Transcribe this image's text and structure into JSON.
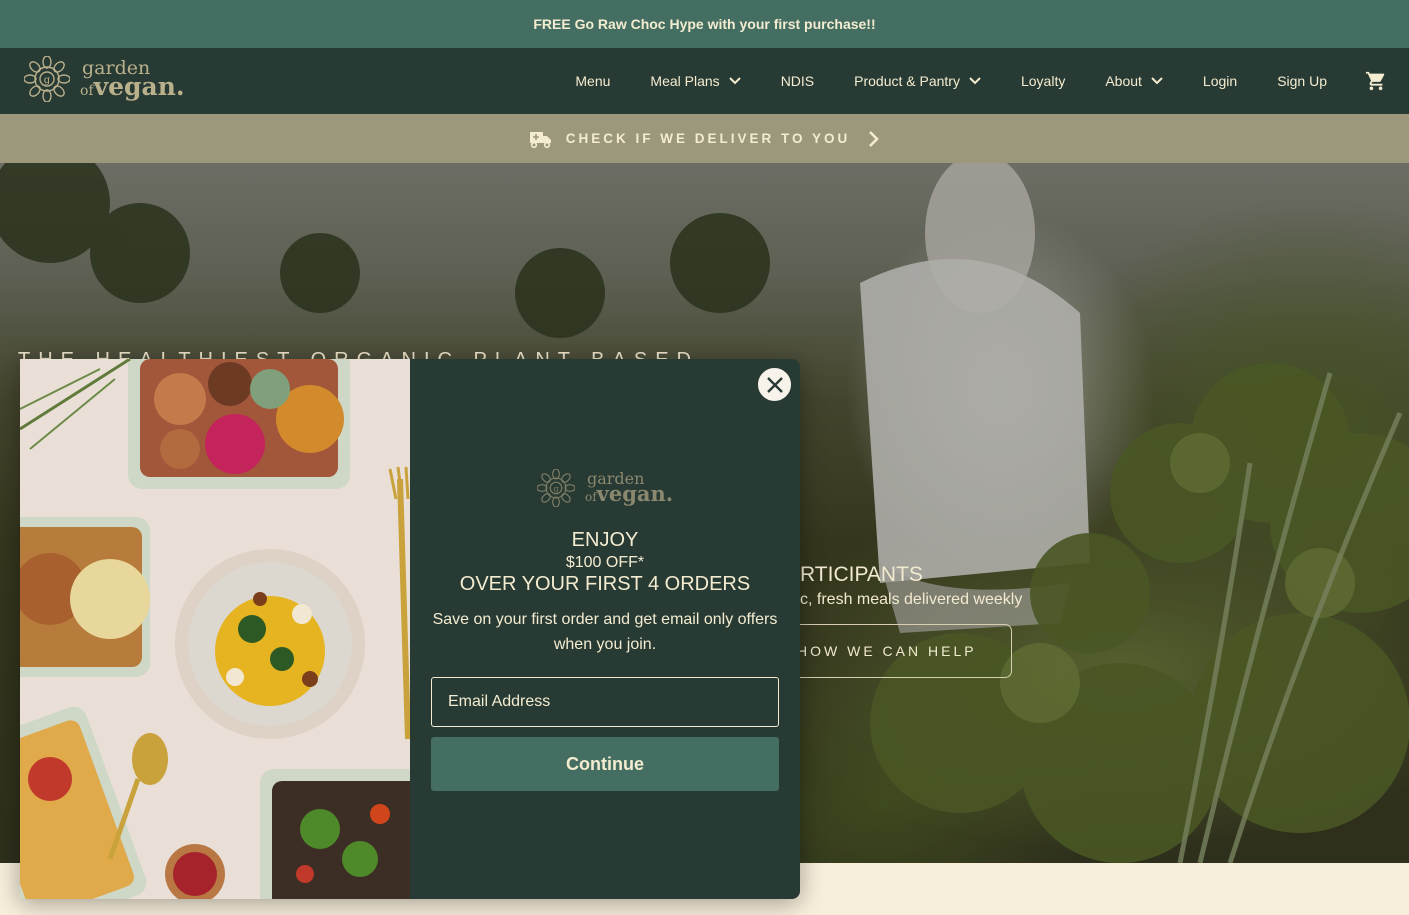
{
  "announcement": {
    "text": "FREE Go Raw Choc Hype with your first purchase!!"
  },
  "brand": {
    "line1": "garden",
    "line2_small": "of",
    "line2_big": "vegan."
  },
  "nav": {
    "items": [
      {
        "label": "Menu",
        "dropdown": false
      },
      {
        "label": "Meal Plans",
        "dropdown": true
      },
      {
        "label": "NDIS",
        "dropdown": false
      },
      {
        "label": "Product & Pantry",
        "dropdown": true
      },
      {
        "label": "Loyalty",
        "dropdown": false
      },
      {
        "label": "About",
        "dropdown": true
      },
      {
        "label": "Login",
        "dropdown": false
      },
      {
        "label": "Sign Up",
        "dropdown": false
      }
    ],
    "cart_icon": "cart-icon"
  },
  "delivery": {
    "label": "CHECK IF WE DELIVER TO YOU",
    "icon": "delivery-truck-icon"
  },
  "hero": {
    "kicker": "THE HEALTHIEST ORGANIC PLANT BASED",
    "heading": "RTICIPANTS",
    "subheading": "c, fresh meals delivered weekly",
    "button_label": "HOW WE CAN HELP"
  },
  "popup": {
    "enjoy": "ENJOY",
    "discount": "$100 OFF*",
    "orders": "OVER YOUR FIRST 4 ORDERS",
    "description": "Save on your first order and get email only offers when you join.",
    "email_placeholder": "Email Address",
    "continue_label": "Continue"
  },
  "colors": {
    "announcement_bg": "#456e62",
    "header_bg": "#283a34",
    "delivery_bg": "#9c987c",
    "popup_bg": "#283a34",
    "button_bg": "#456e62",
    "text_cream": "#f3ecd0"
  }
}
